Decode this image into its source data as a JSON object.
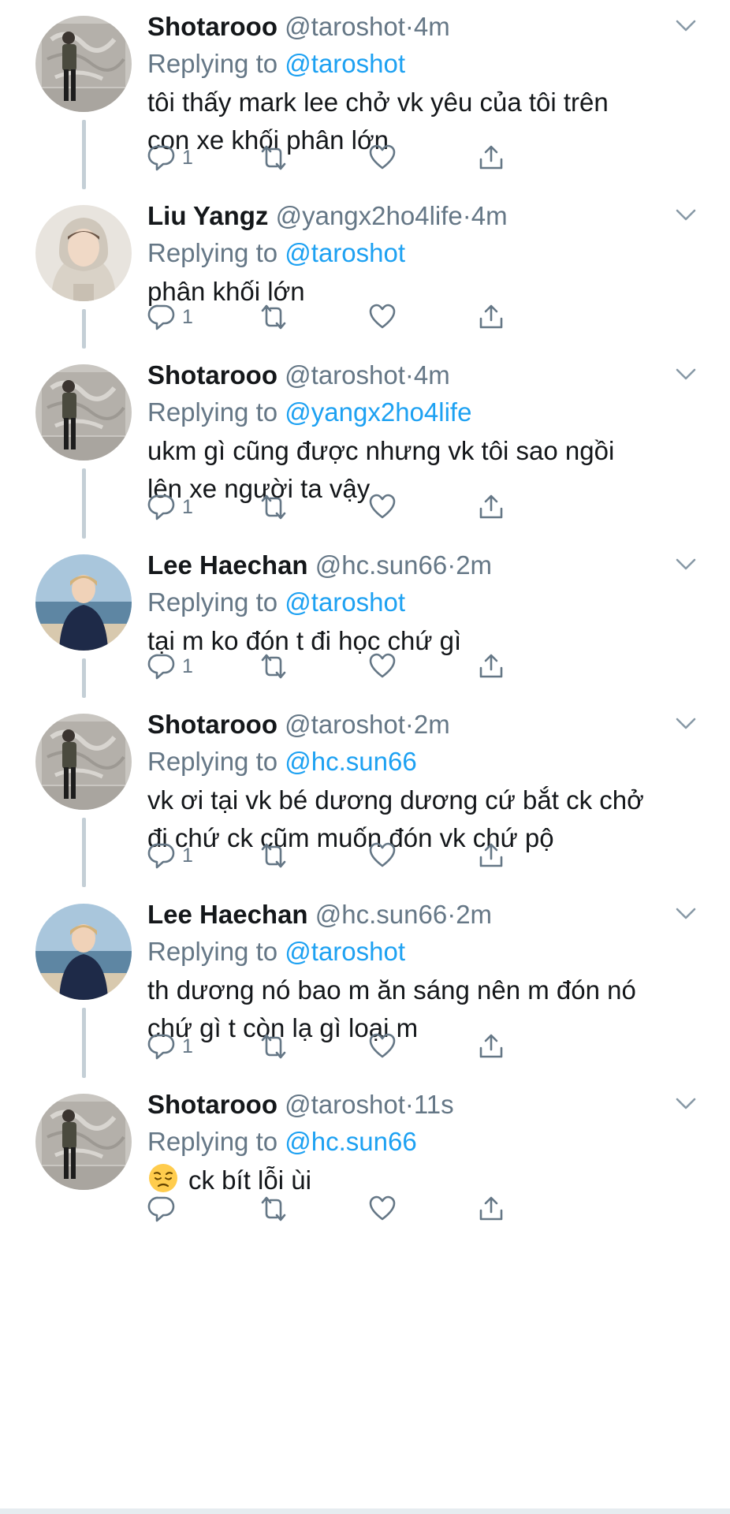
{
  "colors": {
    "link": "#1da1f2",
    "secondary_text": "#657786",
    "primary_text": "#14171a",
    "thread_line": "#c4cfd6"
  },
  "icons": {
    "reply": "reply-icon",
    "retweet": "retweet-icon",
    "like": "heart-icon",
    "share": "share-icon",
    "menu": "chevron-down-icon",
    "pensive": "pensive-face-emoji"
  },
  "tweets": [
    {
      "name": "Shotarooo",
      "handle": "@taroshot",
      "dot": "·",
      "time": "4m",
      "replying_label": "Replying to",
      "replying_to": "@taroshot",
      "text_lines": [
        "tôi thấy mark lee chở vk yêu của tôi trên",
        "con xe khối phân lớn"
      ],
      "reply_count": "1",
      "avatar": "shotarooo"
    },
    {
      "name": "Liu Yangz",
      "handle": "@yangx2ho4life",
      "dot": "·",
      "time": "4m",
      "replying_label": "Replying to",
      "replying_to": "@taroshot",
      "text_lines": [
        "phân khối lớn"
      ],
      "reply_count": "1",
      "avatar": "liu"
    },
    {
      "name": "Shotarooo",
      "handle": "@taroshot",
      "dot": "·",
      "time": "4m",
      "replying_label": "Replying to",
      "replying_to": "@yangx2ho4life",
      "text_lines": [
        "ukm gì cũng được nhưng vk tôi sao ngồi",
        "lên xe người ta vậy"
      ],
      "reply_count": "1",
      "avatar": "shotarooo"
    },
    {
      "name": "Lee Haechan",
      "handle": "@hc.sun66",
      "dot": "·",
      "time": "2m",
      "replying_label": "Replying to",
      "replying_to": "@taroshot",
      "text_lines": [
        "tại m ko đón t đi học chứ gì"
      ],
      "reply_count": "1",
      "avatar": "haechan"
    },
    {
      "name": "Shotarooo",
      "handle": "@taroshot",
      "dot": "·",
      "time": "2m",
      "replying_label": "Replying to",
      "replying_to": "@hc.sun66",
      "text_lines": [
        "vk ơi tại vk bé dương dương cứ bắt ck chở",
        "đi chứ ck cũm muốn đón vk chứ pộ"
      ],
      "reply_count": "1",
      "avatar": "shotarooo"
    },
    {
      "name": "Lee Haechan",
      "handle": "@hc.sun66",
      "dot": "·",
      "time": "2m",
      "replying_label": "Replying to",
      "replying_to": "@taroshot",
      "text_lines": [
        "th dương nó bao m ăn sáng nên m đón nó",
        "chứ gì t còn lạ gì loại m"
      ],
      "reply_count": "1",
      "avatar": "haechan"
    },
    {
      "name": "Shotarooo",
      "handle": "@taroshot",
      "dot": "·",
      "time": "11s",
      "replying_label": "Replying to",
      "replying_to": "@hc.sun66",
      "text_lines": [
        "ck bít lỗi ùi"
      ],
      "reply_count": "",
      "avatar": "shotarooo",
      "emoji": "pensive"
    }
  ]
}
